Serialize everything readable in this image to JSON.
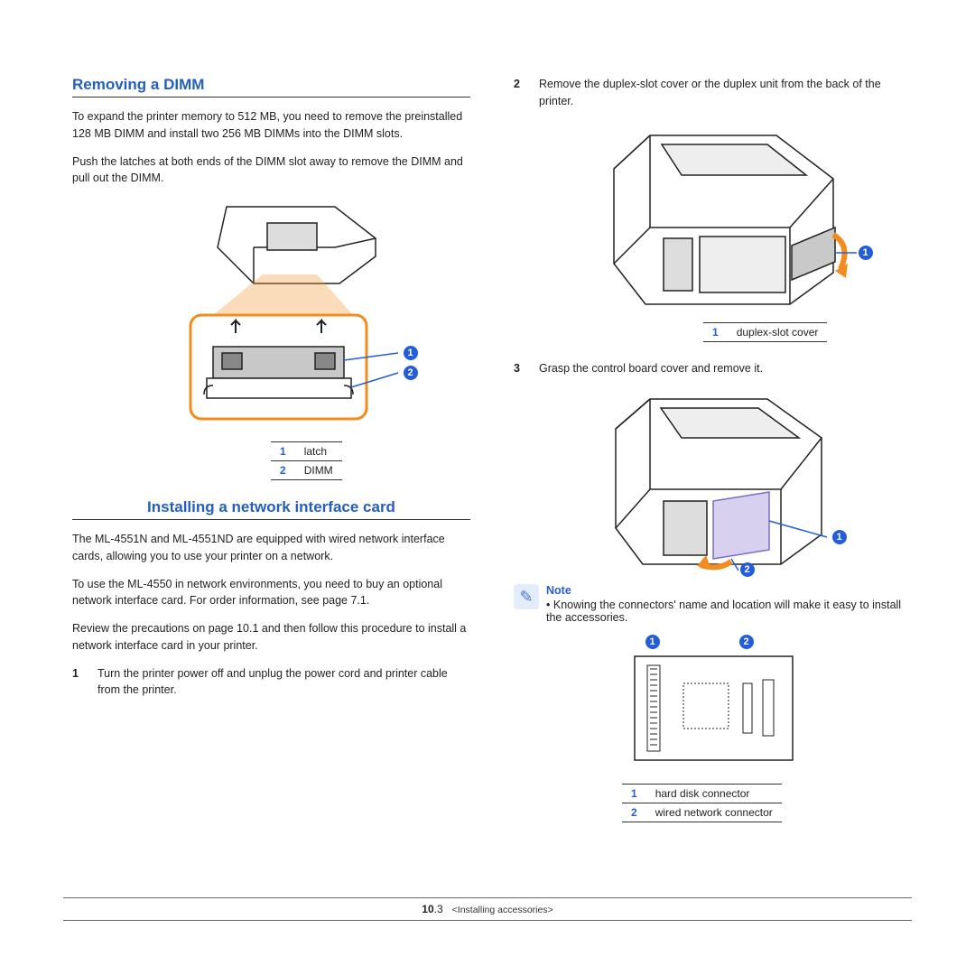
{
  "left": {
    "heading1": "Removing a DIMM",
    "para1": "To expand the printer memory to 512 MB, you need to remove the preinstalled 128 MB DIMM and install two 256 MB DIMMs into the DIMM slots.",
    "para2": "Push the latches at both ends of the DIMM slot away to remove the DIMM and pull out the DIMM.",
    "legend1": {
      "1": "latch",
      "2": "DIMM"
    },
    "heading2": "Installing a network interface card",
    "para3": "The ML-4551N and ML-4551ND are equipped with wired network interface cards, allowing you to use your printer on a network.",
    "para4": "To use the ML-4550 in network environments, you need to buy an optional network interface card. For order information, see page 7.1.",
    "para5": "Review the precautions on page 10.1 and then follow this procedure to install a network interface card in your printer.",
    "step1num": "1",
    "step1": "Turn the printer power off and unplug the power cord and printer cable from the printer."
  },
  "right": {
    "step2num": "2",
    "step2": "Remove the duplex-slot cover or the duplex unit from the back of the printer.",
    "legend2": {
      "1": "duplex-slot cover"
    },
    "step3num": "3",
    "step3": "Grasp the control board cover and remove it.",
    "note_title": "Note",
    "note_body": "Knowing the connectors' name and location will make it easy to install the accessories.",
    "legend3": {
      "1": "hard disk connector",
      "2": "wired network connector"
    }
  },
  "callouts": {
    "one": "1",
    "two": "2"
  },
  "footer": {
    "pagenum": "10",
    "pagesub": ".3",
    "chapter": "<Installing accessories>"
  }
}
